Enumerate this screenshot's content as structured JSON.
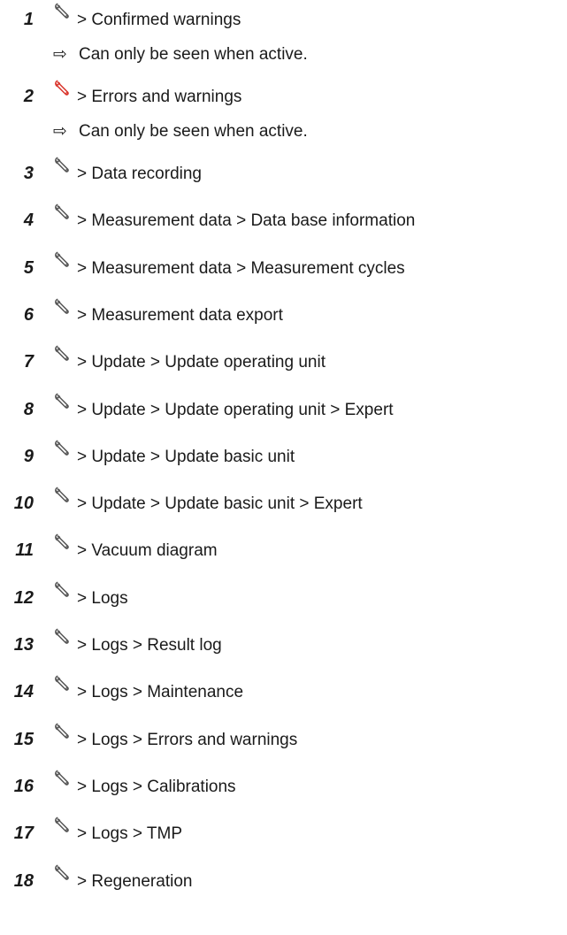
{
  "items": [
    {
      "number": "1",
      "path": "> Confirmed warnings",
      "icon": "wrench-icon",
      "icon_color": "#555555",
      "note_arrow": "⇨",
      "note": "Can only be seen when active."
    },
    {
      "number": "2",
      "path": "> Errors and warnings",
      "icon": "wrench-icon",
      "icon_color": "#d9342b",
      "note_arrow": "⇨",
      "note": "Can only be seen when active."
    },
    {
      "number": "3",
      "path": "> Data recording",
      "icon": "wrench-icon",
      "icon_color": "#555555"
    },
    {
      "number": "4",
      "path": "> Measurement data > Data base information",
      "icon": "wrench-icon",
      "icon_color": "#555555"
    },
    {
      "number": "5",
      "path": "> Measurement data > Measurement cycles",
      "icon": "wrench-icon",
      "icon_color": "#555555"
    },
    {
      "number": "6",
      "path": "> Measurement data export",
      "icon": "wrench-icon",
      "icon_color": "#555555"
    },
    {
      "number": "7",
      "path": "> Update > Update operating unit",
      "icon": "wrench-icon",
      "icon_color": "#555555"
    },
    {
      "number": "8",
      "path": "> Update > Update operating unit > Expert",
      "icon": "wrench-icon",
      "icon_color": "#555555"
    },
    {
      "number": "9",
      "path": "> Update > Update basic unit",
      "icon": "wrench-icon",
      "icon_color": "#555555"
    },
    {
      "number": "10",
      "path": "> Update > Update basic unit > Expert",
      "icon": "wrench-icon",
      "icon_color": "#555555"
    },
    {
      "number": "11",
      "path": "> Vacuum diagram",
      "icon": "wrench-icon",
      "icon_color": "#555555"
    },
    {
      "number": "12",
      "path": "> Logs",
      "icon": "wrench-icon",
      "icon_color": "#555555"
    },
    {
      "number": "13",
      "path": "> Logs > Result log",
      "icon": "wrench-icon",
      "icon_color": "#555555"
    },
    {
      "number": "14",
      "path": "> Logs > Maintenance",
      "icon": "wrench-icon",
      "icon_color": "#555555"
    },
    {
      "number": "15",
      "path": "> Logs > Errors and warnings",
      "icon": "wrench-icon",
      "icon_color": "#555555"
    },
    {
      "number": "16",
      "path": "> Logs > Calibrations",
      "icon": "wrench-icon",
      "icon_color": "#555555"
    },
    {
      "number": "17",
      "path": "> Logs > TMP",
      "icon": "wrench-icon",
      "icon_color": "#555555"
    },
    {
      "number": "18",
      "path": "> Regeneration",
      "icon": "wrench-icon",
      "icon_color": "#555555"
    }
  ]
}
